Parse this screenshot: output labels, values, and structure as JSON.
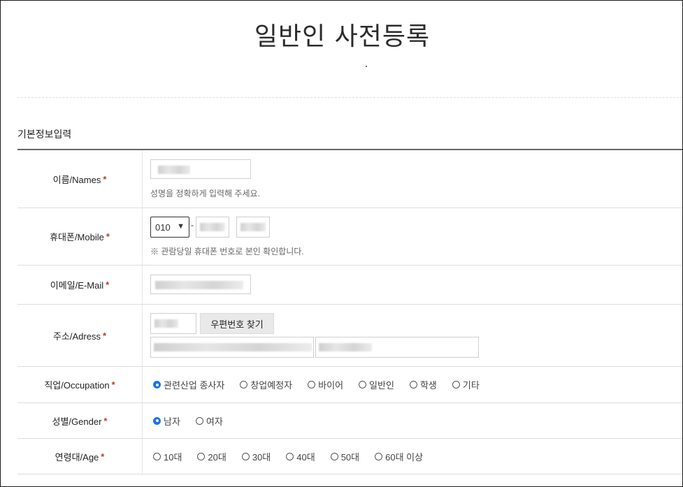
{
  "page": {
    "title": "일반인 사전등록"
  },
  "section": {
    "title": "기본정보입력"
  },
  "required_mark": "*",
  "fields": {
    "name": {
      "label": "이름/Names",
      "help": "성명을 정확하게 입력해 주세요."
    },
    "mobile": {
      "label": "휴대폰/Mobile",
      "prefix": "010",
      "separator": "-",
      "help": "※ 관람당일 휴대폰 번호로 본인 확인합니다."
    },
    "email": {
      "label": "이메일/E-Mail"
    },
    "address": {
      "label": "주소/Adress",
      "postcode_button": "우편번호 찾기"
    },
    "occupation": {
      "label": "직업/Occupation",
      "options": [
        "관련산업 종사자",
        "창업예정자",
        "바이어",
        "일반인",
        "학생",
        "기타"
      ],
      "selected_index": 0
    },
    "gender": {
      "label": "성별/Gender",
      "options": [
        "남자",
        "여자"
      ],
      "selected_index": 0
    },
    "age": {
      "label": "연령대/Age",
      "options": [
        "10대",
        "20대",
        "30대",
        "40대",
        "50대",
        "60대 이상"
      ],
      "selected_index": -1
    }
  },
  "colors": {
    "required": "#c0392b",
    "radio_selected": "#1a73e8"
  }
}
